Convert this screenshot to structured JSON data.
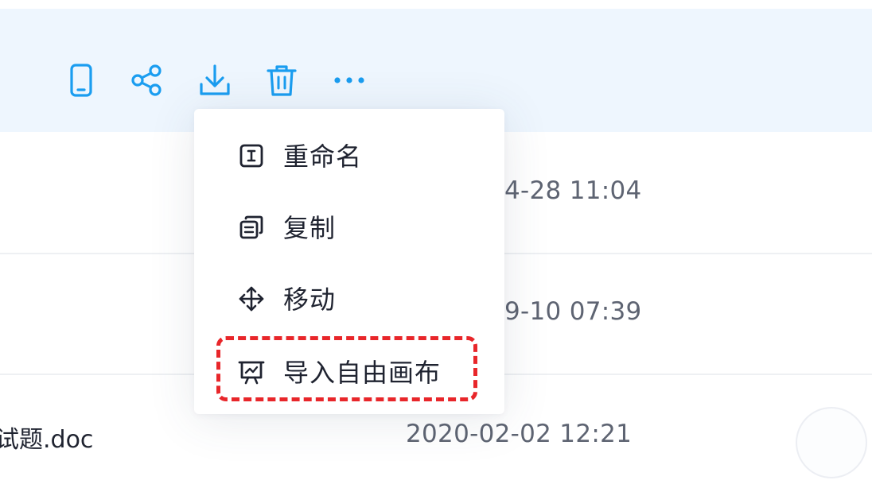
{
  "toolbar": {
    "actions": [
      {
        "name": "mobile-icon",
        "label": "mobile"
      },
      {
        "name": "share-icon",
        "label": "share"
      },
      {
        "name": "download-icon",
        "label": "download"
      },
      {
        "name": "trash-icon",
        "label": "delete"
      },
      {
        "name": "more-icon",
        "label": "more"
      }
    ],
    "accent_color": "#1a9df0"
  },
  "context_menu": {
    "items": [
      {
        "label": "重命名",
        "icon": "rename-icon"
      },
      {
        "label": "复制",
        "icon": "copy-icon"
      },
      {
        "label": "移动",
        "icon": "move-icon"
      },
      {
        "label": "导入自由画布",
        "icon": "canvas-import-icon",
        "highlighted": true
      }
    ],
    "highlight_color": "#e8262a"
  },
  "file_list": {
    "rows": [
      {
        "name": "",
        "modified": "4-28 11:04"
      },
      {
        "name": "",
        "modified": "9-10 07:39"
      },
      {
        "name": "试题.doc",
        "modified": "2020-02-02 12:21"
      }
    ]
  }
}
